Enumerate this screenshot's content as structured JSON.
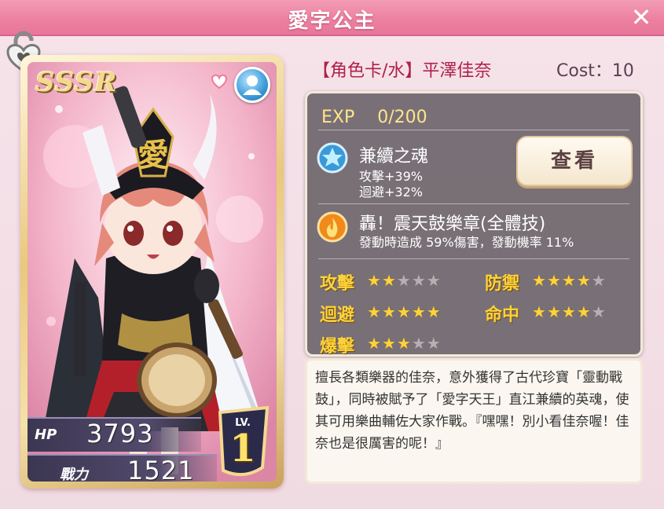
{
  "header": {
    "title": "愛字公主",
    "close_label": "✕"
  },
  "card": {
    "rarity": "SSSR",
    "hp_label": "HP",
    "hp_value": "3793",
    "power_label": "戰力",
    "power_value": "1521",
    "lv_label": "LV.",
    "lv_value": "1"
  },
  "info": {
    "character": "【角色卡/水】平澤佳奈",
    "cost": "Cost：10",
    "exp": "EXP 　0/200",
    "skill1": {
      "name": "兼續之魂",
      "line1": "攻擊+39%",
      "line2": "迴避+32%"
    },
    "view_button": "查看",
    "skill2": {
      "name": "轟！震天鼓樂章(全體技)",
      "desc": "發動時造成 59%傷害，發動機率 11%"
    },
    "attributes": [
      {
        "label": "攻擊",
        "stars": 2
      },
      {
        "label": "防禦",
        "stars": 4
      },
      {
        "label": "迴避",
        "stars": 5
      },
      {
        "label": "命中",
        "stars": 4
      },
      {
        "label": "爆擊",
        "stars": 3
      }
    ],
    "max_stars": 5,
    "description": "擅長各類樂器的佳奈，意外獲得了古代珍寶「靈動戰鼓」，同時被賦予了「愛字天王」直江兼續的英魂，使其可用樂曲輔佐大家作戰。『嘿嘿！別小看佳奈喔！佳奈也是很厲害的呢！』"
  },
  "colors": {
    "header": "#ec7fa0",
    "star_on": "#ffd23a",
    "star_off": "#b8b0b0",
    "name": "#b0204a"
  }
}
